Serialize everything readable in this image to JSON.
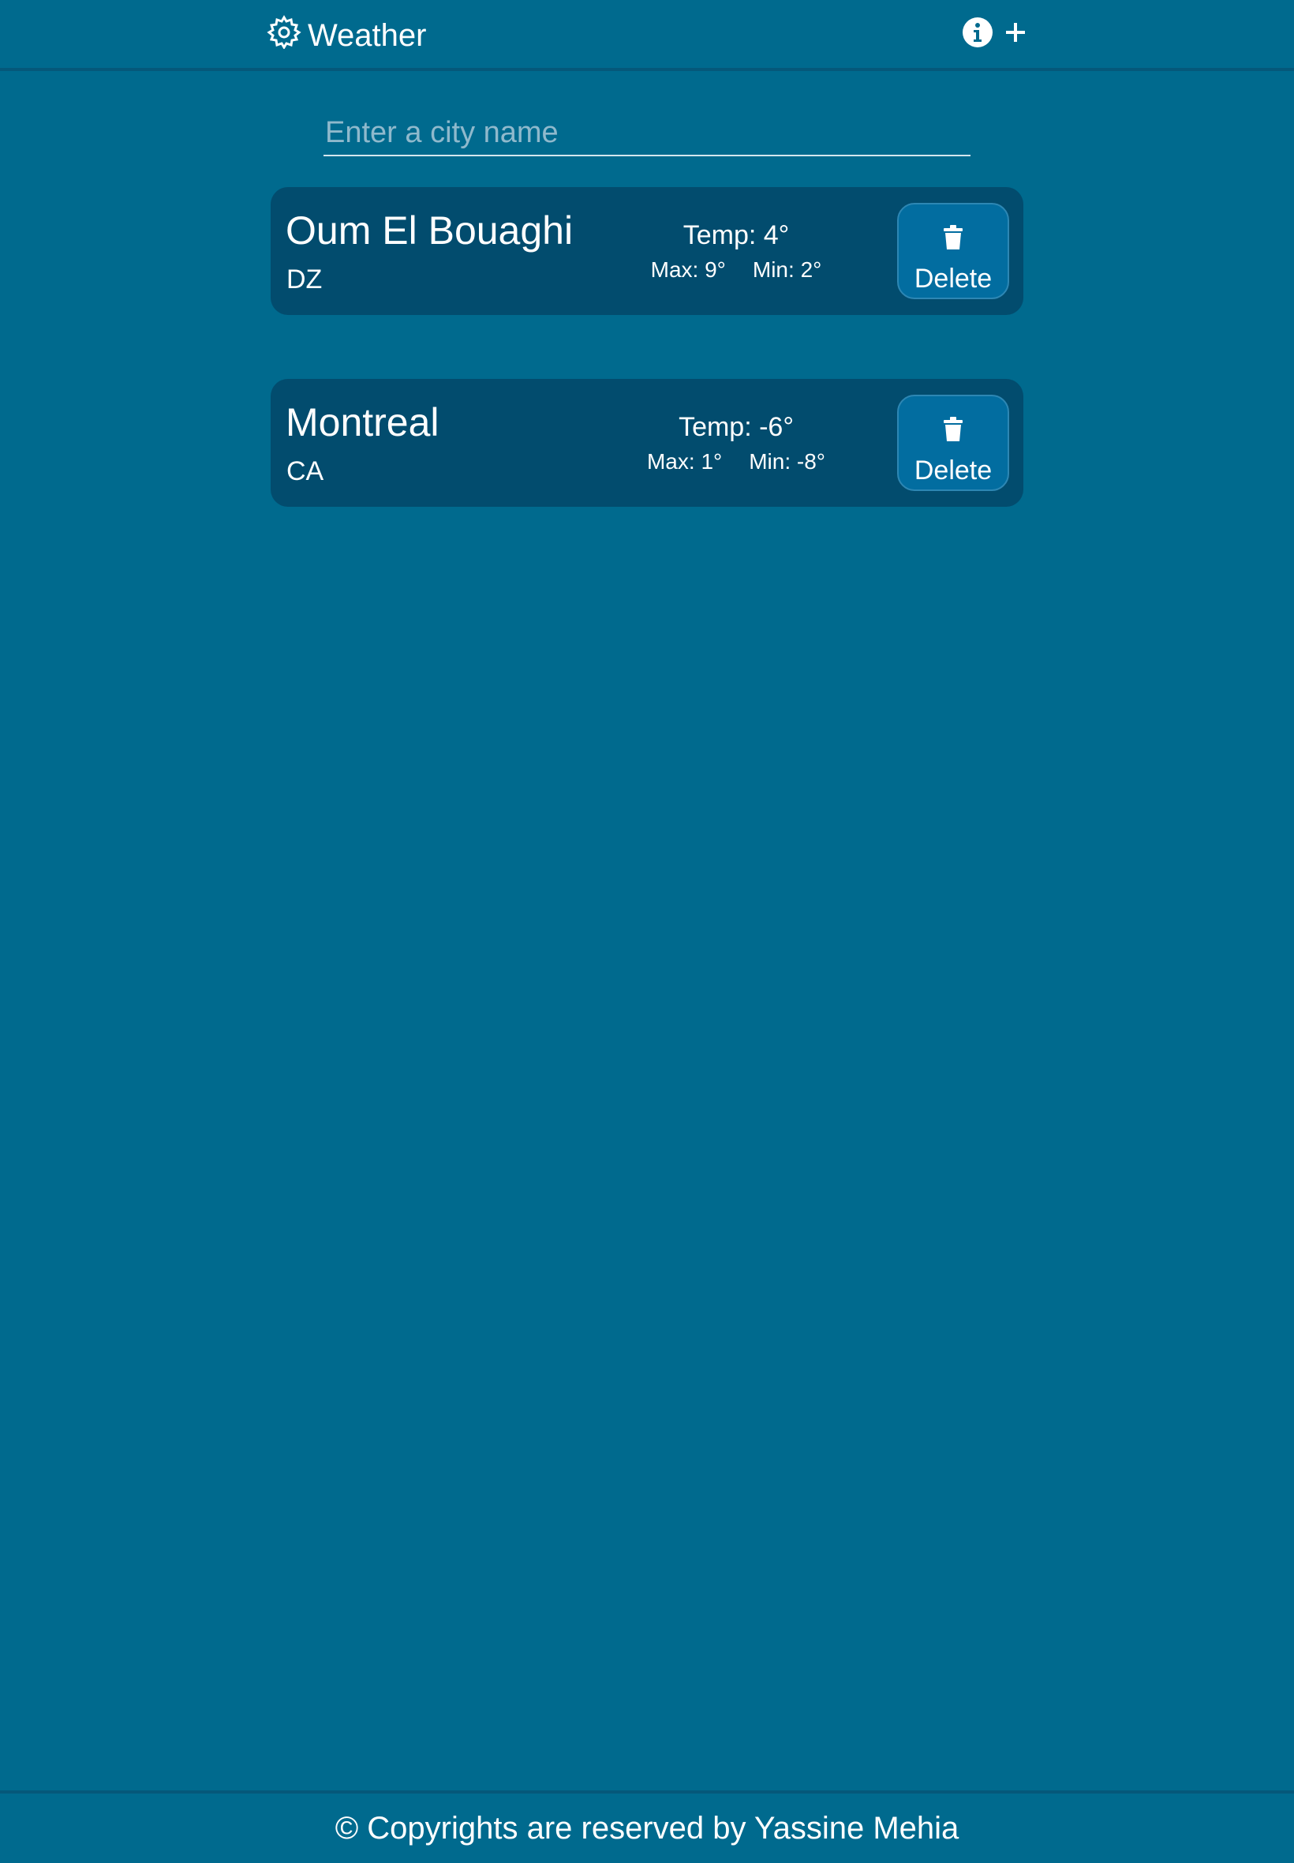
{
  "header": {
    "app_icon": "gear-icon",
    "title": "Weather",
    "actions": [
      {
        "name": "info-button",
        "icon": "info-icon"
      },
      {
        "name": "add-button",
        "icon": "plus-icon"
      }
    ]
  },
  "search": {
    "placeholder": "Enter a city name",
    "value": ""
  },
  "cities": [
    {
      "name": "Oum El Bouaghi",
      "country": "DZ",
      "temp": "Temp: 4°",
      "max": "Max: 9°",
      "min": "Min: 2°",
      "delete_label": "Delete",
      "delete_icon": "trash-icon"
    },
    {
      "name": "Montreal",
      "country": "CA",
      "temp": "Temp: -6°",
      "max": "Max: 1°",
      "min": "Min: -8°",
      "delete_label": "Delete",
      "delete_icon": "trash-icon"
    }
  ],
  "footer": {
    "text": "© Copyrights are reserved by Yassine Mehia"
  },
  "colors": {
    "background": "#006a8e",
    "card": "#024c6e",
    "delete_button": "#026da0",
    "text": "#ffffff"
  }
}
